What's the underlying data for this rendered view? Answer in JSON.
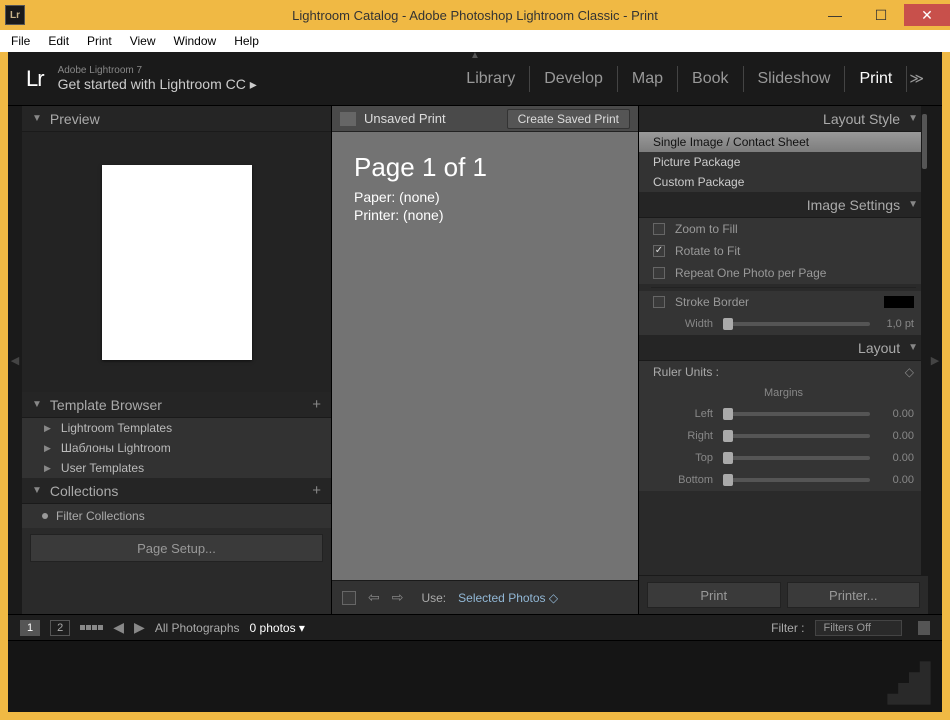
{
  "window": {
    "title": "Lightroom Catalog - Adobe Photoshop Lightroom Classic - Print",
    "icon_text": "Lr"
  },
  "menubar": [
    "File",
    "Edit",
    "Print",
    "View",
    "Window",
    "Help"
  ],
  "header": {
    "logo": "Lr",
    "small": "Adobe Lightroom 7",
    "big": "Get started with Lightroom CC  ▸"
  },
  "modules": [
    "Library",
    "Develop",
    "Map",
    "Book",
    "Slideshow",
    "Print"
  ],
  "active_module": "Print",
  "left": {
    "preview_title": "Preview",
    "template_title": "Template Browser",
    "template_items": [
      "Lightroom Templates",
      "Шаблоны Lightroom",
      "User Templates"
    ],
    "collections_title": "Collections",
    "filter_placeholder": "Filter Collections",
    "page_setup": "Page Setup..."
  },
  "center": {
    "title": "Unsaved Print",
    "saved_btn": "Create Saved Print",
    "page_line": "Page 1 of 1",
    "paper_line": "Paper:  (none)",
    "printer_line": "Printer:  (none)",
    "use_label": "Use:",
    "use_value": "Selected Photos"
  },
  "right": {
    "layout_style_title": "Layout Style",
    "styles": [
      "Single Image / Contact Sheet",
      "Picture Package",
      "Custom Package"
    ],
    "image_settings_title": "Image Settings",
    "zoom_fill": "Zoom to Fill",
    "rotate_fit": "Rotate to Fit",
    "repeat": "Repeat One Photo per Page",
    "stroke": "Stroke Border",
    "width_label": "Width",
    "width_val": "1,0 pt",
    "layout_title": "Layout",
    "ruler_label": "Ruler Units :",
    "margins_title": "Margins",
    "margins": {
      "Left": "0.00",
      "Right": "0.00",
      "Top": "0.00",
      "Bottom": "0.00"
    },
    "print_btn": "Print",
    "printer_btn": "Printer..."
  },
  "filmstrip": {
    "source": "All Photographs",
    "count": "0 photos",
    "filter_label": "Filter :",
    "filter_value": "Filters Off"
  }
}
